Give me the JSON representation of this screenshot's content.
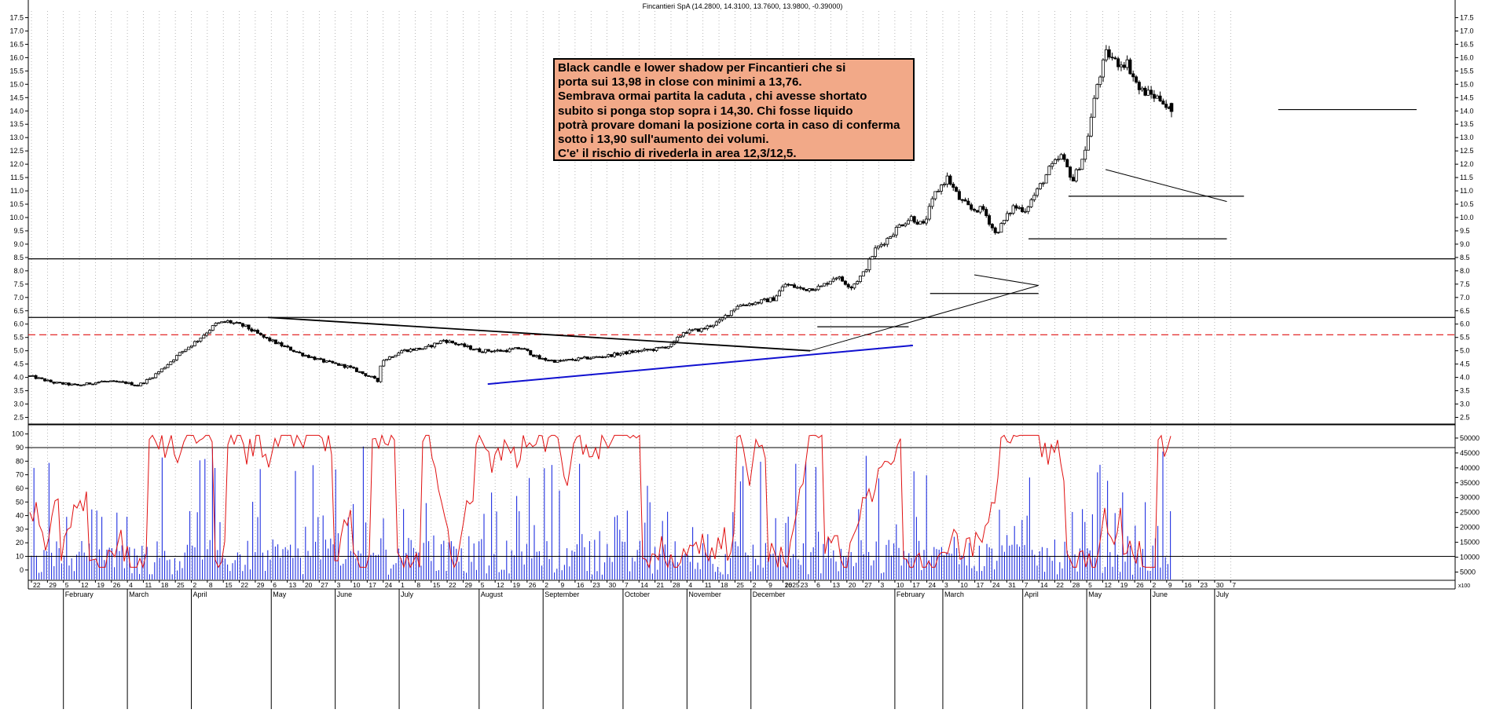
{
  "chart_data": [
    {
      "type": "candlestick",
      "title": "Fincantieri SpA (14.2800, 14.3100, 13.7600, 13.9800, -0.39000)",
      "ylim": [
        2.25,
        17.75
      ],
      "y_ticks": [
        "2.5",
        "3.0",
        "3.5",
        "4.0",
        "4.5",
        "5.0",
        "5.5",
        "6.0",
        "6.5",
        "7.0",
        "7.5",
        "8.0",
        "8.5",
        "9.0",
        "9.5",
        "10.0",
        "10.5",
        "11.0",
        "11.5",
        "12.0",
        "12.5",
        "13.0",
        "13.5",
        "14.0",
        "14.5",
        "15.0",
        "15.5",
        "16.0",
        "16.5",
        "17.0",
        "17.5"
      ],
      "grid": "vertical dotted",
      "price_path": [
        {
          "d": 0,
          "v": 4.05
        },
        {
          "d": 20,
          "v": 3.8
        },
        {
          "d": 40,
          "v": 3.7
        },
        {
          "d": 60,
          "v": 3.85
        },
        {
          "d": 80,
          "v": 3.8
        },
        {
          "d": 90,
          "v": 3.7
        },
        {
          "d": 100,
          "v": 3.95
        },
        {
          "d": 110,
          "v": 4.3
        },
        {
          "d": 125,
          "v": 4.9
        },
        {
          "d": 140,
          "v": 5.4
        },
        {
          "d": 155,
          "v": 6.0
        },
        {
          "d": 165,
          "v": 6.1
        },
        {
          "d": 180,
          "v": 5.9
        },
        {
          "d": 195,
          "v": 5.5
        },
        {
          "d": 210,
          "v": 5.2
        },
        {
          "d": 225,
          "v": 4.9
        },
        {
          "d": 245,
          "v": 4.6
        },
        {
          "d": 265,
          "v": 4.4
        },
        {
          "d": 285,
          "v": 4.0
        },
        {
          "d": 290,
          "v": 3.85
        },
        {
          "d": 293,
          "v": 4.6
        },
        {
          "d": 310,
          "v": 5.0
        },
        {
          "d": 330,
          "v": 5.1
        },
        {
          "d": 345,
          "v": 5.4
        },
        {
          "d": 360,
          "v": 5.2
        },
        {
          "d": 375,
          "v": 5.0
        },
        {
          "d": 395,
          "v": 5.0
        },
        {
          "d": 410,
          "v": 5.1
        },
        {
          "d": 425,
          "v": 4.7
        },
        {
          "d": 440,
          "v": 4.6
        },
        {
          "d": 460,
          "v": 4.7
        },
        {
          "d": 480,
          "v": 4.8
        },
        {
          "d": 500,
          "v": 4.95
        },
        {
          "d": 520,
          "v": 5.05
        },
        {
          "d": 535,
          "v": 5.2
        },
        {
          "d": 545,
          "v": 5.7
        },
        {
          "d": 560,
          "v": 5.8
        },
        {
          "d": 575,
          "v": 6.1
        },
        {
          "d": 590,
          "v": 6.7
        },
        {
          "d": 605,
          "v": 6.8
        },
        {
          "d": 620,
          "v": 6.95
        },
        {
          "d": 630,
          "v": 7.5
        },
        {
          "d": 645,
          "v": 7.3
        },
        {
          "d": 660,
          "v": 7.4
        },
        {
          "d": 672,
          "v": 7.8
        },
        {
          "d": 685,
          "v": 7.4
        },
        {
          "d": 695,
          "v": 7.9
        },
        {
          "d": 705,
          "v": 8.8
        },
        {
          "d": 715,
          "v": 9.2
        },
        {
          "d": 725,
          "v": 9.7
        },
        {
          "d": 735,
          "v": 10.0
        },
        {
          "d": 745,
          "v": 9.7
        },
        {
          "d": 755,
          "v": 10.9
        },
        {
          "d": 765,
          "v": 11.5
        },
        {
          "d": 775,
          "v": 10.7
        },
        {
          "d": 785,
          "v": 10.3
        },
        {
          "d": 795,
          "v": 10.3
        },
        {
          "d": 805,
          "v": 9.4
        },
        {
          "d": 810,
          "v": 9.7
        },
        {
          "d": 820,
          "v": 10.4
        },
        {
          "d": 830,
          "v": 10.3
        },
        {
          "d": 840,
          "v": 11.0
        },
        {
          "d": 850,
          "v": 11.8
        },
        {
          "d": 860,
          "v": 12.3
        },
        {
          "d": 870,
          "v": 11.4
        },
        {
          "d": 880,
          "v": 12.5
        },
        {
          "d": 890,
          "v": 15.0
        },
        {
          "d": 898,
          "v": 16.2
        },
        {
          "d": 906,
          "v": 15.8
        },
        {
          "d": 915,
          "v": 15.8
        },
        {
          "d": 925,
          "v": 14.8
        },
        {
          "d": 935,
          "v": 14.6
        },
        {
          "d": 945,
          "v": 14.4
        },
        {
          "d": 950,
          "v": 13.98
        }
      ],
      "hlines": [
        {
          "name": "support-8.5",
          "y": 8.45,
          "x0": 0,
          "x1": 1,
          "color": "#000000",
          "dash": ""
        },
        {
          "name": "level-6.25",
          "y": 6.25,
          "x0": 0,
          "x1": 1,
          "color": "#000000",
          "dash": ""
        },
        {
          "name": "level-5.6-dashed",
          "y": 5.6,
          "x0": 0,
          "x1": 1,
          "color": "#e01010",
          "dash": "9,5"
        },
        {
          "name": "level-14.05",
          "y": 14.05,
          "x0": 0.876,
          "x1": 0.973,
          "color": "#000000",
          "dash": ""
        },
        {
          "name": "level-10.8",
          "y": 10.8,
          "x0": 0.729,
          "x1": 0.852,
          "color": "#000000",
          "dash": ""
        },
        {
          "name": "level-9.2",
          "y": 9.2,
          "x0": 0.701,
          "x1": 0.84,
          "color": "#000000",
          "dash": ""
        },
        {
          "name": "level-7.15",
          "y": 7.15,
          "x0": 0.632,
          "x1": 0.708,
          "color": "#000000",
          "dash": ""
        },
        {
          "name": "level-5.9",
          "y": 5.9,
          "x0": 0.553,
          "x1": 0.617,
          "color": "#000000",
          "dash": ""
        }
      ],
      "trendlines": [
        {
          "name": "resistance-down",
          "x0": 0.168,
          "y0": 6.25,
          "x1": 0.548,
          "y1": 5.0,
          "color": "#000000",
          "w": 1.8
        },
        {
          "name": "support-up-blue",
          "x0": 0.322,
          "y0": 3.75,
          "x1": 0.62,
          "y1": 5.2,
          "color": "#1010d0",
          "w": 2
        },
        {
          "name": "uptrend-thin",
          "x0": 0.548,
          "y0": 5.0,
          "x1": 0.708,
          "y1": 7.45,
          "color": "#000000",
          "w": 1
        },
        {
          "name": "wedge-top",
          "x0": 0.663,
          "y0": 7.85,
          "x1": 0.708,
          "y1": 7.45,
          "color": "#000000",
          "w": 1
        },
        {
          "name": "flag-top",
          "x0": 0.755,
          "y0": 11.8,
          "x1": 0.84,
          "y1": 10.6,
          "color": "#000000",
          "w": 1
        }
      ],
      "annotation": [
        "Black candle e lower shadow per Fincantieri che si",
        "porta sui 13,98 in close con minimi a 13,76.",
        "Sembrava ormai partita la caduta , chi avesse shortato",
        "subito si ponga stop sopra i 14,30. Chi fosse liquido",
        "potrà provare domani la posizione corta in caso di conferma",
        "sotto i 13,90 sull'aumento dei volumi.",
        "C'e' il rischio di rivederla in area 12,3/12,5."
      ]
    },
    {
      "type": "line+bar",
      "left_ticks": [
        "0",
        "10",
        "20",
        "30",
        "40",
        "50",
        "60",
        "70",
        "80",
        "90",
        "100"
      ],
      "right_ticks": [
        "5000",
        "10000",
        "15000",
        "20000",
        "25000",
        "30000",
        "35000",
        "40000",
        "45000",
        "50000"
      ],
      "right_unit_label": "x100",
      "hlines": [
        {
          "name": "oscillator-90-line",
          "y": 90
        },
        {
          "name": "oscillator-10-line",
          "y": 10
        }
      ],
      "oscillator_series_color": "#e01010",
      "volume_series_color": "#2030e0"
    }
  ],
  "x_axis": {
    "day_labels": [
      "22",
      "29",
      "5",
      "12",
      "19",
      "26",
      "4",
      "11",
      "18",
      "25",
      "2",
      "8",
      "15",
      "22",
      "29",
      "6",
      "13",
      "20",
      "27",
      "3",
      "10",
      "17",
      "24",
      "1",
      "8",
      "15",
      "22",
      "29",
      "5",
      "12",
      "19",
      "26",
      "2",
      "9",
      "16",
      "23",
      "30",
      "7",
      "14",
      "21",
      "28",
      "4",
      "11",
      "18",
      "25",
      "2",
      "9",
      "16",
      "23",
      "6",
      "13",
      "20",
      "27",
      "3",
      "10",
      "17",
      "24",
      "3",
      "10",
      "17",
      "24",
      "31",
      "7",
      "14",
      "22",
      "28",
      "5",
      "12",
      "19",
      "26",
      "2",
      "9",
      "16",
      "23",
      "30",
      "7"
    ],
    "year_label": "2025",
    "month_labels": [
      "February",
      "March",
      "April",
      "May",
      "June",
      "July",
      "August",
      "September",
      "October",
      "November",
      "December",
      "February",
      "March",
      "April",
      "May",
      "June",
      "July"
    ]
  }
}
